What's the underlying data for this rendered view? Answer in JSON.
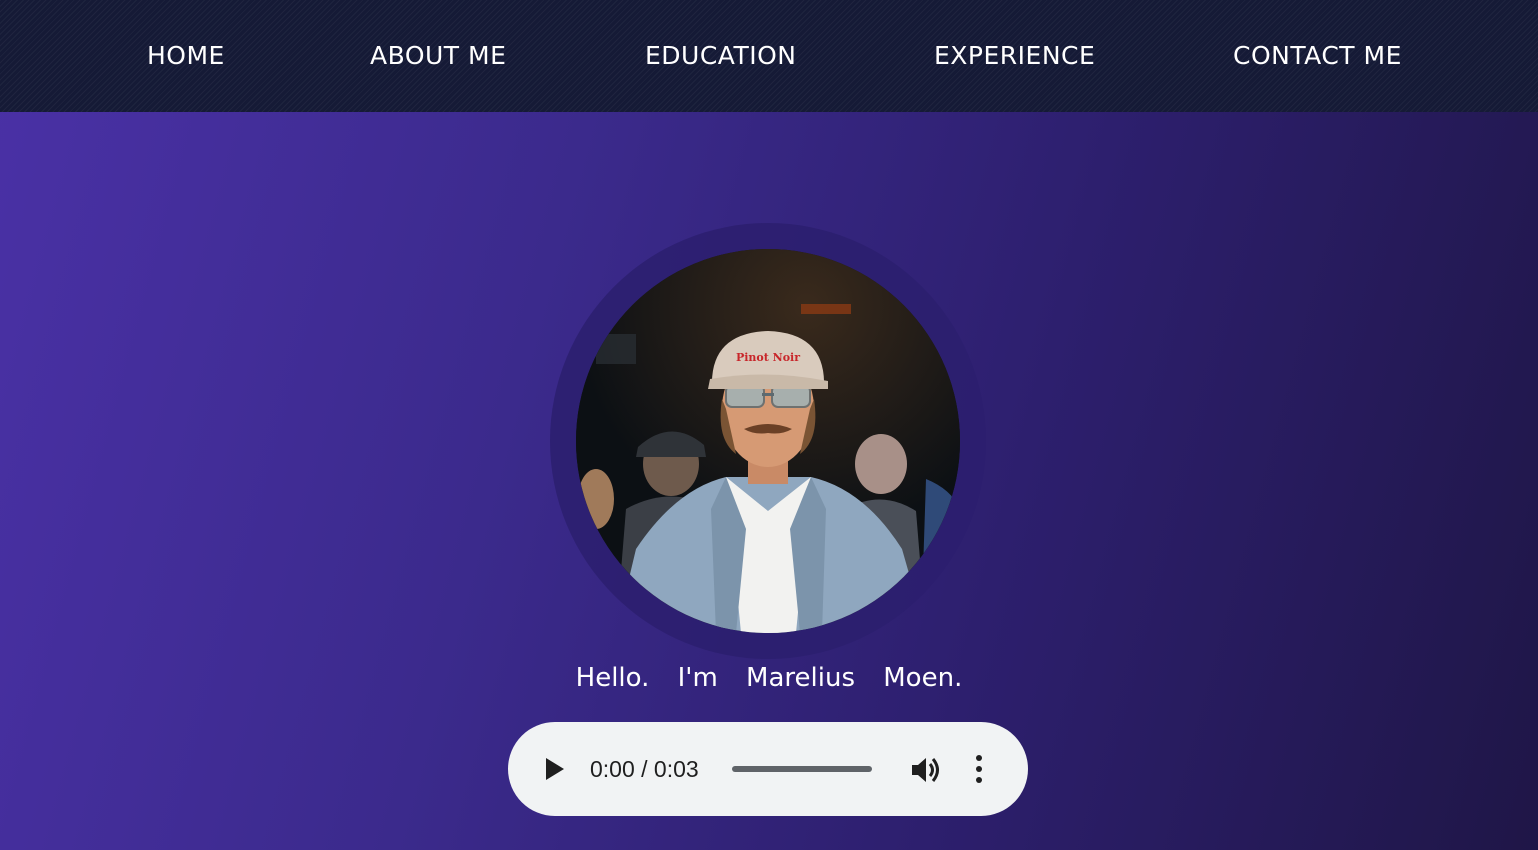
{
  "nav": {
    "items": [
      {
        "label": "HOME"
      },
      {
        "label": "ABOUT ME"
      },
      {
        "label": "EDUCATION"
      },
      {
        "label": "EXPERIENCE"
      },
      {
        "label": "CONTACT ME"
      }
    ]
  },
  "hero": {
    "greeting": "Hello. I'm Marelius Moen.",
    "avatar_cap_text": "Pinot Noir"
  },
  "audio": {
    "time": "0:00 / 0:03",
    "progress": 0
  },
  "colors": {
    "nav_bg": "#151a36",
    "accent_start": "#4a31a6",
    "accent_end": "#1f1647",
    "player_bg": "#f1f3f4"
  },
  "icons": [
    "play-icon",
    "volume-icon",
    "more-vert-icon"
  ]
}
